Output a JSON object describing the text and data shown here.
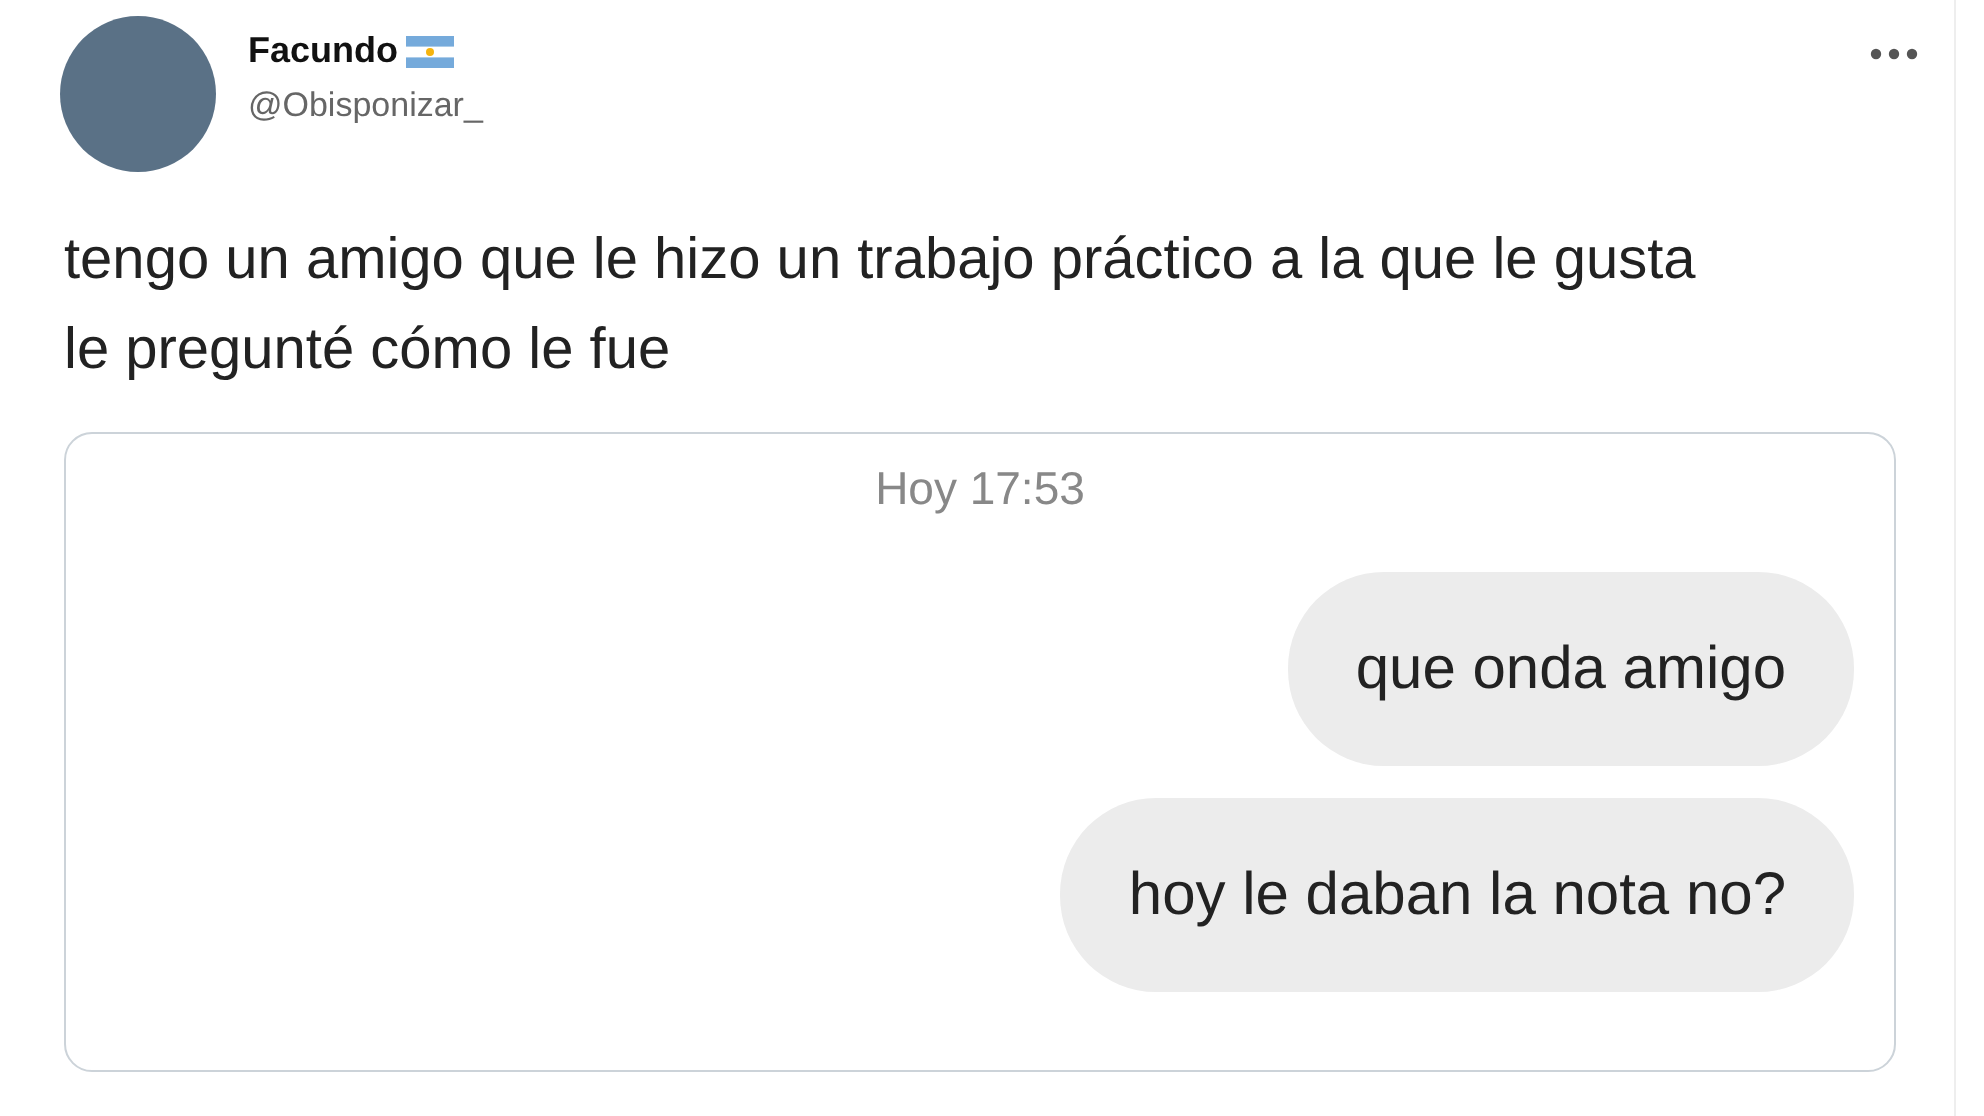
{
  "author": {
    "name": "Facundo",
    "handle": "@Obisponizar_"
  },
  "text": "tengo un amigo que le hizo un trabajo práctico a la que le gusta\nle pregunté cómo le fue",
  "chat": {
    "timestamp": "Hoy 17:53",
    "messages": [
      {
        "text": "que onda amigo",
        "outgoing": true
      },
      {
        "text": "hoy le daban la nota no?",
        "outgoing": true
      }
    ]
  }
}
